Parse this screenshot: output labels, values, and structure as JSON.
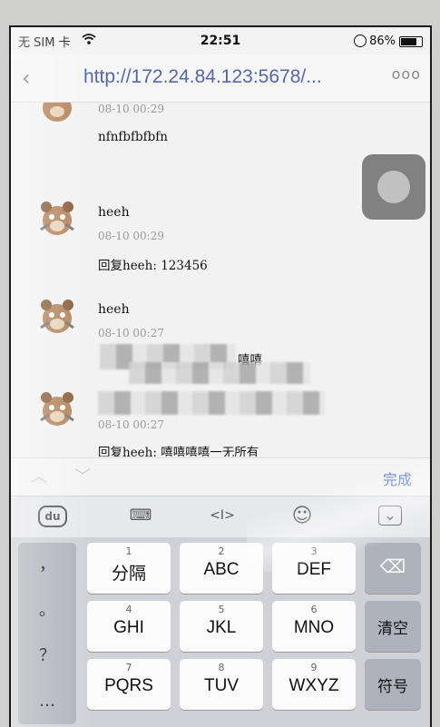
{
  "status_bar": {
    "carrier": "无 SIM 卡",
    "time": "22:51",
    "battery": "86%"
  },
  "navbar": {
    "back_icon": "‹",
    "url": "http://172.24.84.123:5678/...",
    "more_icon": "ooo"
  },
  "messages": [
    {
      "name": "",
      "date": "08-10 00:29",
      "text": "nfnfbfbfbfn"
    },
    {
      "name": "heeh",
      "date": "08-10 00:29",
      "text": "回复heeh: 123456"
    },
    {
      "name": "heeh",
      "date": "08-10 00:27",
      "text": "嘻嘻"
    },
    {
      "name": "",
      "date": "08-10 00:27",
      "text": "回复heeh: 嘻嘻嘻嘻一无所有"
    }
  ],
  "toolbar": {
    "up_icon": "︿",
    "down_icon": "﹀",
    "done": "完成"
  },
  "keyboard_tools": {
    "ime_icon": "du",
    "keyboard_icon": "⌨",
    "cursor_icon": "<I>",
    "emoji_icon": "☺",
    "collapse_icon": "⌄"
  },
  "keyboard": {
    "punct": [
      "，",
      "。",
      "？",
      "…"
    ],
    "keys": [
      {
        "num": "1",
        "label": "分隔"
      },
      {
        "num": "2",
        "label": "ABC"
      },
      {
        "num": "3",
        "label": "DEF"
      },
      {
        "num": "4",
        "label": "GHI"
      },
      {
        "num": "5",
        "label": "JKL"
      },
      {
        "num": "6",
        "label": "MNO"
      },
      {
        "num": "7",
        "label": "PQRS"
      },
      {
        "num": "8",
        "label": "TUV"
      },
      {
        "num": "9",
        "label": "WXYZ"
      }
    ],
    "delete_icon": "⌫",
    "clear": "清空",
    "symbol": "符号"
  }
}
